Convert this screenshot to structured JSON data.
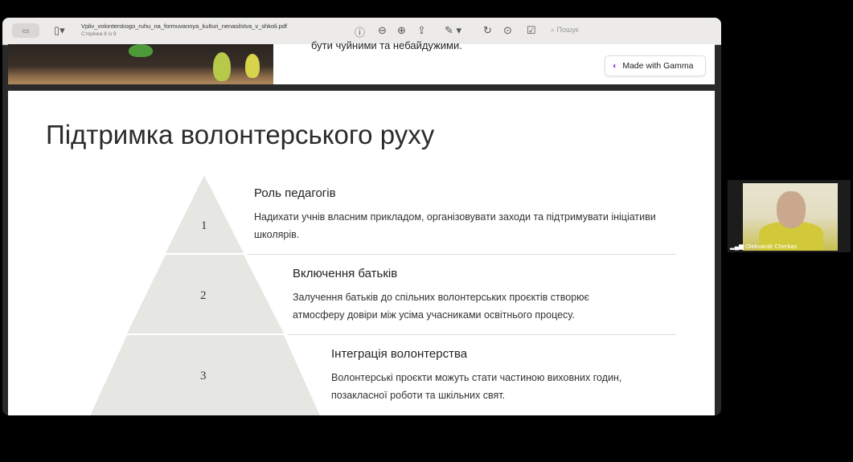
{
  "toolbar": {
    "file_name": "Vpliv_volonterskogo_ruhu_na_formuvannya_kulturi_nenasilstva_v_shkoli.pdf",
    "page_info": "Сторінка 8 із 9",
    "search_placeholder": "Пошук"
  },
  "slide_prev": {
    "text": "бути чуйними та небайдужими.",
    "badge": "Made with Gamma"
  },
  "slide": {
    "title": "Підтримка волонтерського руху",
    "levels": [
      {
        "num": "1",
        "heading": "Роль педагогів",
        "desc": "Надихати учнів власним прикладом, організовувати заходи та підтримувати ініціативи школярів."
      },
      {
        "num": "2",
        "heading": "Включення батьків",
        "desc": "Залучення батьків до спільних волонтерських проєктів створює атмосферу довіри між усіма учасниками освітнього процесу."
      },
      {
        "num": "3",
        "heading": "Інтеграція волонтерства",
        "desc": "Волонтерські проєкти можуть стати частиною виховних годин, позакласної роботи та шкільних свят."
      }
    ]
  },
  "participant": {
    "name": "Oleksandr Cherkas"
  }
}
